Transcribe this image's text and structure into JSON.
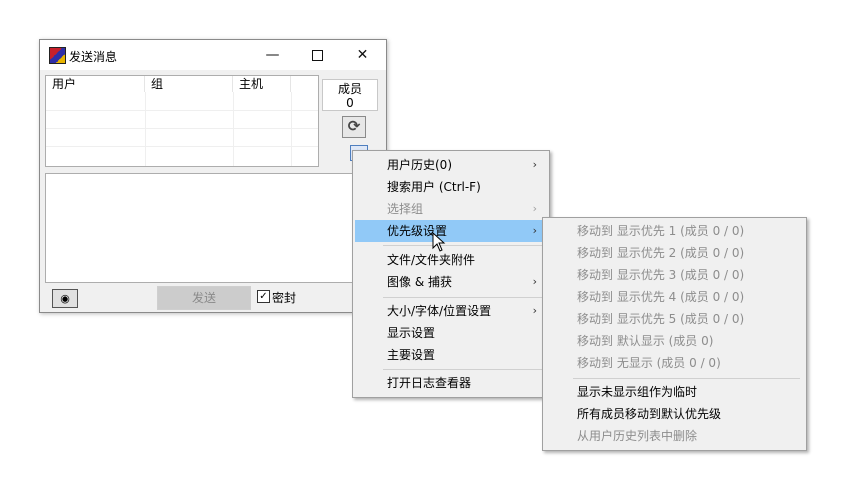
{
  "window": {
    "title": "发送消息",
    "minimize_glyph": "—",
    "close_glyph": "✕",
    "columns": [
      "用户",
      "组",
      "主机"
    ],
    "member_label": "成员",
    "member_count": "0",
    "refresh_glyph": "⟳",
    "camera_glyph": "◉",
    "send_label": "发送",
    "secret_checked_glyph": "✓",
    "secret_label": "密封"
  },
  "context_menu": {
    "items": [
      {
        "label": "用户历史(0)",
        "submenu": true,
        "disabled": false
      },
      {
        "label": "搜索用户 (Ctrl-F)",
        "submenu": false,
        "disabled": false
      },
      {
        "label": "选择组",
        "submenu": true,
        "disabled": true
      },
      {
        "label": "优先级设置",
        "submenu": true,
        "disabled": false,
        "selected": true
      },
      {
        "label": "文件/文件夹附件",
        "submenu": false,
        "disabled": false
      },
      {
        "label": "图像 & 捕获",
        "submenu": true,
        "disabled": false
      },
      {
        "label": "大小/字体/位置设置",
        "submenu": true,
        "disabled": false
      },
      {
        "label": "显示设置",
        "submenu": false,
        "disabled": false
      },
      {
        "label": "主要设置",
        "submenu": false,
        "disabled": false
      },
      {
        "label": "打开日志查看器",
        "submenu": false,
        "disabled": false
      }
    ],
    "arrow_glyph": "›"
  },
  "priority_submenu": {
    "items": [
      {
        "label": "移动到 显示优先 1 (成员  0 /  0)",
        "disabled": true
      },
      {
        "label": "移动到 显示优先 2 (成员  0 /  0)",
        "disabled": true
      },
      {
        "label": "移动到 显示优先 3 (成员  0 /  0)",
        "disabled": true
      },
      {
        "label": "移动到 显示优先 4 (成员  0 /  0)",
        "disabled": true
      },
      {
        "label": "移动到 显示优先 5 (成员  0 /  0)",
        "disabled": true
      },
      {
        "label": "移动到 默认显示   (成员  0)",
        "disabled": true
      },
      {
        "label": "移动到 无显示   (成员  0 /  0)",
        "disabled": true
      },
      {
        "label": "显示未显示组作为临时",
        "disabled": false
      },
      {
        "label": "所有成员移动到默认优先级",
        "disabled": false
      },
      {
        "label": "从用户历史列表中删除",
        "disabled": true
      }
    ]
  },
  "colors": {
    "menu_highlight": "#91c9f7",
    "disabled_text": "#8d8d8d",
    "window_bg": "#f0f0f0"
  }
}
